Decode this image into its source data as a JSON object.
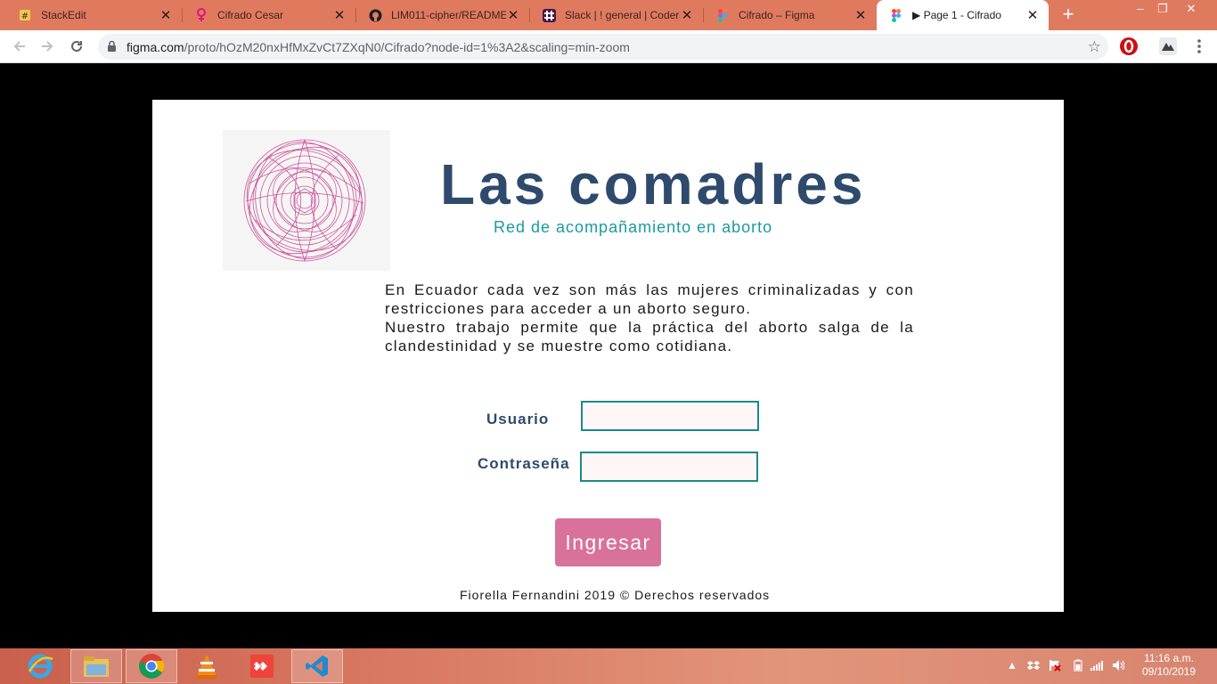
{
  "browser": {
    "tabs": [
      {
        "title": "StackEdit",
        "icon": "stackedit-icon",
        "close": "✕"
      },
      {
        "title": "Cifrado Cesar",
        "icon": "female-symbol-icon",
        "close": "✕"
      },
      {
        "title": "LIM011-cipher/README",
        "icon": "github-icon",
        "close": "✕"
      },
      {
        "title": "Slack | ! general | Coders",
        "icon": "slack-icon",
        "close": "✕"
      },
      {
        "title": "Cifrado – Figma",
        "icon": "figma-icon",
        "close": "✕"
      },
      {
        "title": "▶ Page 1 - Cifrado",
        "icon": "figma-icon",
        "close": "✕"
      }
    ],
    "active_tab": 5,
    "new_tab": "+",
    "window_controls": {
      "minimize": "–",
      "restore": "❐",
      "close": "✕"
    },
    "address": {
      "host": "figma.com",
      "path": "/proto/hOzM20nxHfMxZvCt7ZXqN0/Cifrado?node-id=1%3A2&scaling=min-zoom"
    },
    "bookmark_star": "☆"
  },
  "page": {
    "title": "Las comadres",
    "subtitle": "Red de acompañamiento en aborto",
    "intro": [
      "En Ecuador cada vez son más las mujeres criminalizadas y con restricciones para acceder a un aborto seguro.",
      "Nuestro trabajo permite que la práctica del aborto salga de la clandestinidad y se muestre como cotidiana."
    ],
    "form": {
      "username_label": "Usuario",
      "username_value": "",
      "password_label": "Contraseña",
      "password_value": "",
      "submit_label": "Ingresar"
    },
    "footer": "Fiorella Fernandini 2019 © Derechos reservados"
  },
  "colors": {
    "brand_navy": "#2e4a6c",
    "teal": "#1a9aa0",
    "button_pink": "#d8729b",
    "logo_magenta": "#c43a8a",
    "tab_strip": "#e07a5f"
  },
  "taskbar": {
    "apps": [
      "internet-explorer-icon",
      "file-explorer-icon",
      "chrome-icon",
      "vlc-icon",
      "anydesk-icon",
      "vscode-icon"
    ],
    "clock": {
      "time": "11:16 a.m.",
      "date": "09/10/2019"
    }
  }
}
